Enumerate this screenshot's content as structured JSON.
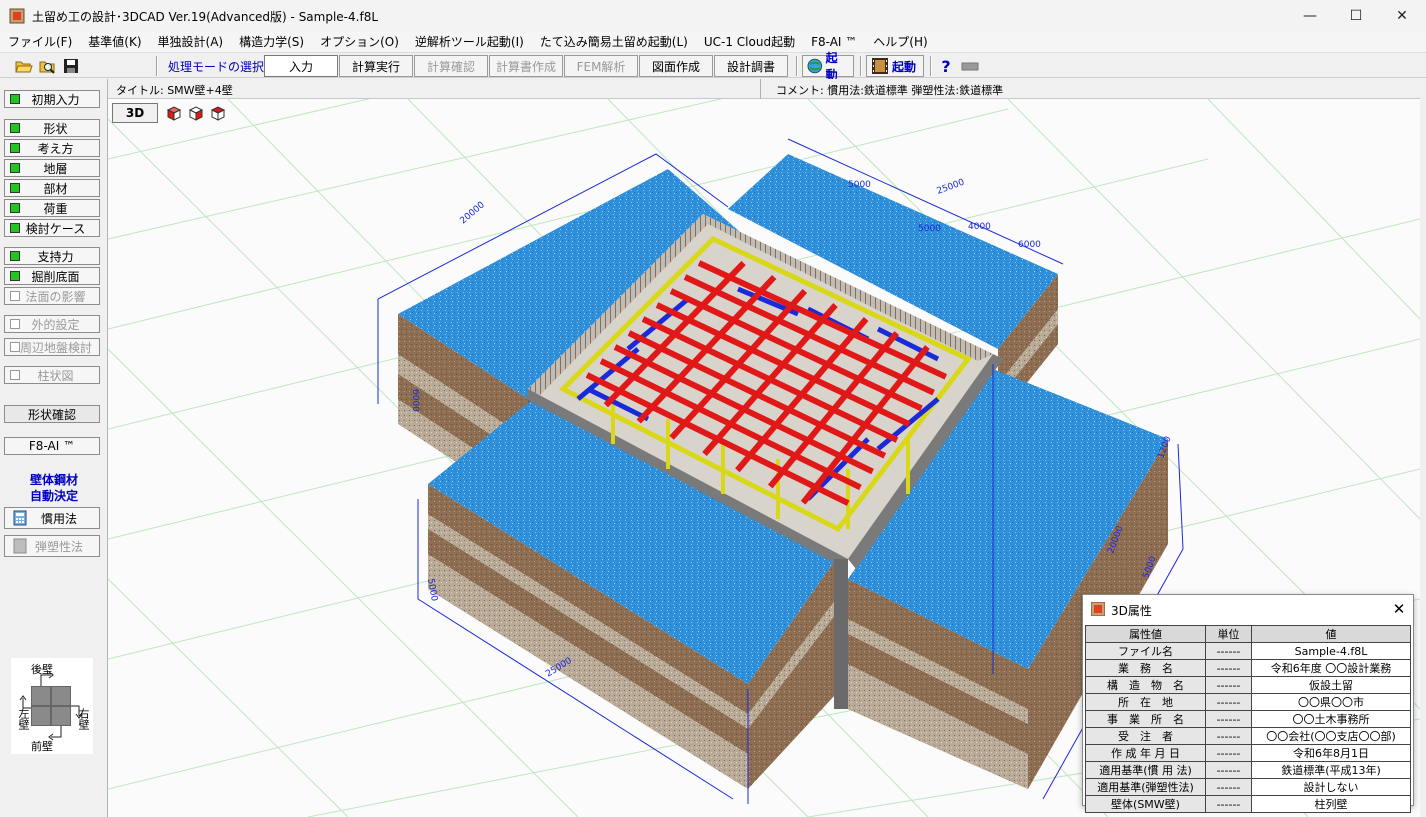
{
  "window": {
    "title": "土留め工の設計･3DCAD Ver.19(Advanced版) - Sample-4.f8L",
    "minimize": "—",
    "maximize": "☐",
    "close": "✕"
  },
  "menu": [
    "ファイル(F)",
    "基準値(K)",
    "単独設計(A)",
    "構造力学(S)",
    "オプション(O)",
    "逆解析ツール起動(I)",
    "たて込み簡易土留め起動(L)",
    "UC-1 Cloud起動",
    "F8-AI ™",
    "ヘルプ(H)"
  ],
  "toolbar": {
    "mode_label": "処理モードの選択",
    "buttons": {
      "input": "入力",
      "calc_run": "計算実行",
      "calc_check": "計算確認",
      "report_create": "計算書作成",
      "fem": "FEM解析",
      "drawing": "図面作成",
      "design_report": "設計調書"
    },
    "launch1": "起動",
    "launch2": "起動",
    "help_icon": "?"
  },
  "infobar": {
    "title": "タイトル: SMW壁+4壁",
    "comment": "コメント: 慣用法:鉄道標準  弾塑性法:鉄道標準"
  },
  "leftpanel": {
    "initial_input": "初期入力",
    "shape": "形状",
    "approach": "考え方",
    "strata": "地層",
    "members": "部材",
    "loads": "荷重",
    "cases": "検討ケース",
    "bearing": "支持力",
    "excavation_bottom": "掘削底面",
    "slope_effect": "法面の影響",
    "external_setting": "外的設定",
    "neighbor_check": "周辺地盤検討",
    "column_diagram": "柱状図",
    "shape_check": "形状確認",
    "f8ai": "F8-AI ™",
    "wall_steel_1": "壁体鋼材",
    "wall_steel_2": "自動決定",
    "conventional": "慣用法",
    "elastoplastic": "弾塑性法"
  },
  "compass": {
    "back": "後壁",
    "front": "前壁",
    "left": "左壁",
    "right": "右壁"
  },
  "viewport": {
    "btn_3d": "3D",
    "dims": {
      "d25000": "25000",
      "d5000": "5000",
      "d6000": "6000",
      "d4000": "4000",
      "d20000": "20000",
      "d1200": "1200"
    }
  },
  "dialog": {
    "title": "3D属性",
    "headers": [
      "属性値",
      "単位",
      "値"
    ],
    "rows": [
      {
        "key": "ファイル名",
        "unit": "------",
        "value": "Sample-4.f8L"
      },
      {
        "key": "業　務　名",
        "unit": "------",
        "value": "令和6年度 〇〇設計業務"
      },
      {
        "key": "構　造　物　名",
        "unit": "------",
        "value": "仮設土留"
      },
      {
        "key": "所　在　地",
        "unit": "------",
        "value": "〇〇県〇〇市"
      },
      {
        "key": "事　業　所　名",
        "unit": "------",
        "value": "〇〇土木事務所"
      },
      {
        "key": "受　注　者",
        "unit": "------",
        "value": "〇〇会社(〇〇支店〇〇部)"
      },
      {
        "key": "作 成 年 月 日",
        "unit": "------",
        "value": "令和6年8月1日"
      },
      {
        "key": "適用基準(慣 用 法)",
        "unit": "------",
        "value": "鉄道標準(平成13年)"
      },
      {
        "key": "適用基準(弾塑性法)",
        "unit": "------",
        "value": "設計しない"
      },
      {
        "key": "壁体(SMW壁)",
        "unit": "------",
        "value": "柱列壁"
      }
    ]
  },
  "colors": {
    "accent_blue": "#0000c0",
    "water": "#2f8fd8",
    "soil_brown": "#9b7a5e",
    "strut_red": "#e01818",
    "brace_blue": "#1a2ad8",
    "post_yellow": "#d8d818",
    "check_green": "#22c522"
  }
}
